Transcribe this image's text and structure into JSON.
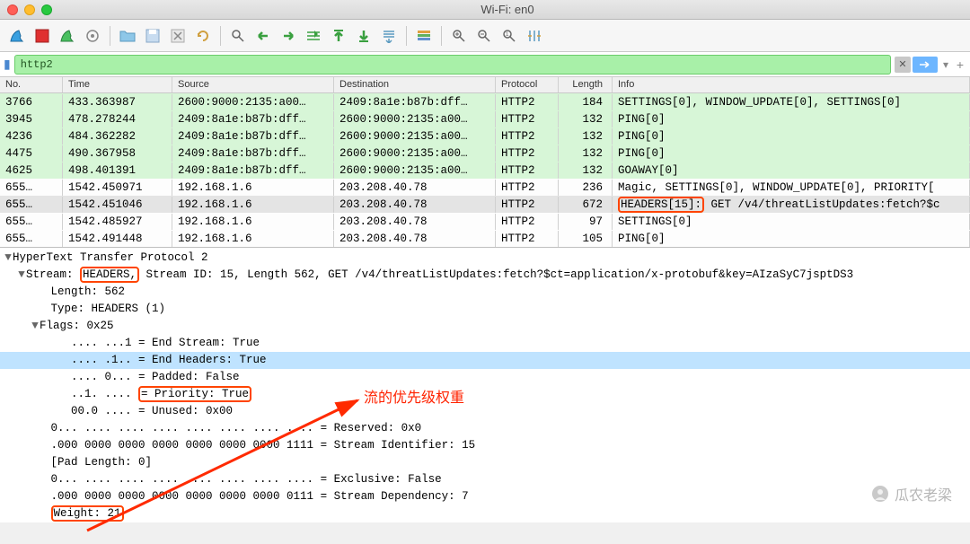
{
  "window": {
    "title": "Wi-Fi: en0"
  },
  "filter": {
    "value": "http2"
  },
  "columns": [
    "No.",
    "Time",
    "Source",
    "Destination",
    "Protocol",
    "Length",
    "Info"
  ],
  "rows": [
    {
      "no": "3766",
      "time": "433.363987",
      "src": "2600:9000:2135:a00…",
      "dst": "2409:8a1e:b87b:dff…",
      "proto": "HTTP2",
      "len": "184",
      "info": "SETTINGS[0], WINDOW_UPDATE[0], SETTINGS[0]",
      "cls": "g"
    },
    {
      "no": "3945",
      "time": "478.278244",
      "src": "2409:8a1e:b87b:dff…",
      "dst": "2600:9000:2135:a00…",
      "proto": "HTTP2",
      "len": "132",
      "info": "PING[0]",
      "cls": "g"
    },
    {
      "no": "4236",
      "time": "484.362282",
      "src": "2409:8a1e:b87b:dff…",
      "dst": "2600:9000:2135:a00…",
      "proto": "HTTP2",
      "len": "132",
      "info": "PING[0]",
      "cls": "g"
    },
    {
      "no": "4475",
      "time": "490.367958",
      "src": "2409:8a1e:b87b:dff…",
      "dst": "2600:9000:2135:a00…",
      "proto": "HTTP2",
      "len": "132",
      "info": "PING[0]",
      "cls": "g"
    },
    {
      "no": "4625",
      "time": "498.401391",
      "src": "2409:8a1e:b87b:dff…",
      "dst": "2600:9000:2135:a00…",
      "proto": "HTTP2",
      "len": "132",
      "info": "GOAWAY[0]",
      "cls": "g"
    },
    {
      "no": "655…",
      "time": "1542.450971",
      "src": "192.168.1.6",
      "dst": "203.208.40.78",
      "proto": "HTTP2",
      "len": "236",
      "info": "Magic, SETTINGS[0], WINDOW_UPDATE[0], PRIORITY[",
      "cls": "w"
    },
    {
      "no": "655…",
      "time": "1542.451046",
      "src": "192.168.1.6",
      "dst": "203.208.40.78",
      "proto": "HTTP2",
      "len": "672",
      "info": "",
      "cls": "sel",
      "special": true,
      "info_left": "HEADERS[15]:",
      "info_right": " GET /v4/threatListUpdates:fetch?$c"
    },
    {
      "no": "655…",
      "time": "1542.485927",
      "src": "192.168.1.6",
      "dst": "203.208.40.78",
      "proto": "HTTP2",
      "len": "97",
      "info": "SETTINGS[0]",
      "cls": "w"
    },
    {
      "no": "655…",
      "time": "1542.491448",
      "src": "192.168.1.6",
      "dst": "203.208.40.78",
      "proto": "HTTP2",
      "len": "105",
      "info": "PING[0]",
      "cls": "w"
    }
  ],
  "details": {
    "root": "HyperText Transfer Protocol 2",
    "stream_pre": "Stream: ",
    "stream_box": "HEADERS,",
    "stream_post": " Stream ID: 15, Length 562, GET /v4/threatListUpdates:fetch?$ct=application/x-protobuf&key=AIzaSyC7jsptDS3",
    "length": "Length: 562",
    "type": "Type: HEADERS (1)",
    "flags": "Flags: 0x25",
    "f1": ".... ...1 = End Stream: True",
    "f2": ".... .1.. = End Headers: True",
    "f3": ".... 0... = Padded: False",
    "f4_pre": "..1. .... ",
    "f4_box": "= Priority: True",
    "f5": "00.0 .... = Unused: 0x00",
    "b1": "0... .... .... .... .... .... .... .... = Reserved: 0x0",
    "b2": ".000 0000 0000 0000 0000 0000 0000 1111 = Stream Identifier: 15",
    "b3": "[Pad Length: 0]",
    "b4": "0... .... .... .... .... .... .... .... = Exclusive: False",
    "b5": ".000 0000 0000 0000 0000 0000 0000 0111 = Stream Dependency: 7",
    "weight": "Weight: 21"
  },
  "annotation": "流的优先级权重",
  "watermark": "瓜农老梁"
}
